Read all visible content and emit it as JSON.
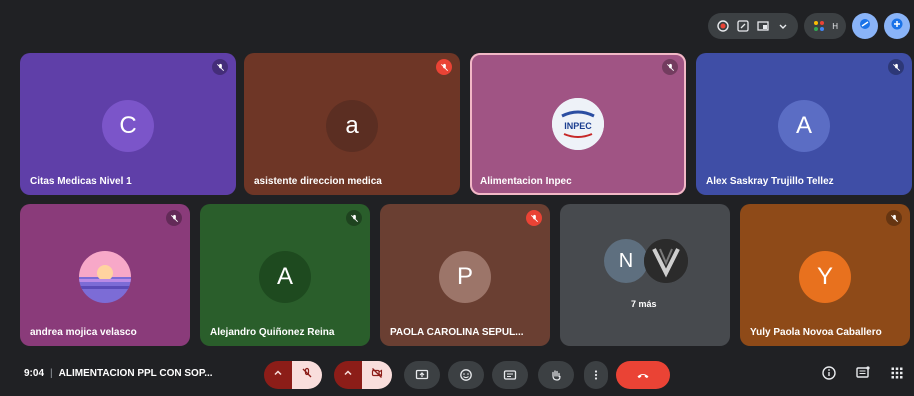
{
  "colors": {
    "background": "#202124",
    "control_bg": "#3c4043",
    "muted_red": "#8c1d18",
    "muted_red_light": "#f9dedc",
    "end_call_red": "#ea4335",
    "accent_blue": "#8ab4f8",
    "highlight_border": "#f2b8c6"
  },
  "top_bar": {
    "icons": [
      "record-icon",
      "edit-icon",
      "layout-icon",
      "chevron-down-icon",
      "apps-icon",
      "avatar-icon",
      "effects-icon",
      "add-icon"
    ],
    "small_label": "H"
  },
  "participants": [
    {
      "name": "Citas Medicas Nivel 1",
      "initial": "C",
      "bg": "#5f3fa8",
      "avatar_bg": "#7b55c9",
      "mic": "muted"
    },
    {
      "name": "asistente direccion medica",
      "initial": "a",
      "bg": "#6e3626",
      "avatar_bg": "#5b2e22",
      "mic": "muted"
    },
    {
      "name": "Alimentacion Inpec",
      "initial": "",
      "avatar_label": "INPEC",
      "bg": "#a05484",
      "avatar_bg": "#eef2f8",
      "mic": "muted",
      "highlighted": true
    },
    {
      "name": "Alex Saskray Trujillo Tellez",
      "initial": "A",
      "bg": "#3f4ea6",
      "avatar_bg": "#5b6dc4",
      "mic": "muted"
    },
    {
      "name": "andrea mojica velasco",
      "initial": "",
      "bg": "#8a3b7a",
      "avatar_bg": "#f0a6c9",
      "mic": "muted"
    },
    {
      "name": "Alejandro Quiñonez Reina",
      "initial": "A",
      "bg": "#2a5e2b",
      "avatar_bg": "#1e4a1f",
      "mic": "muted"
    },
    {
      "name": "PAOLA CAROLINA SEPUL...",
      "initial": "P",
      "bg": "#6a3f32",
      "avatar_bg": "#9c7569",
      "mic": "muted"
    },
    {
      "name": "",
      "initial": "N",
      "more_label": "7 más",
      "bg": "#474a4e",
      "avatar_bg": "#5e6f7f",
      "mic": "none"
    },
    {
      "name": "Yuly Paola Novoa Caballero",
      "initial": "Y",
      "bg": "#8e4a18",
      "avatar_bg": "#e8711e",
      "mic": "muted"
    }
  ],
  "bottom_bar": {
    "time": "9:04",
    "meeting_title": "ALIMENTACION PPL CON SOP...",
    "controls": [
      "mic-options",
      "mic-off",
      "camera-options",
      "camera-off",
      "present",
      "emoji",
      "captions",
      "raise-hand",
      "more-options",
      "end-call"
    ],
    "right_controls": [
      "info-icon",
      "chat-icon",
      "activities-icon"
    ]
  }
}
